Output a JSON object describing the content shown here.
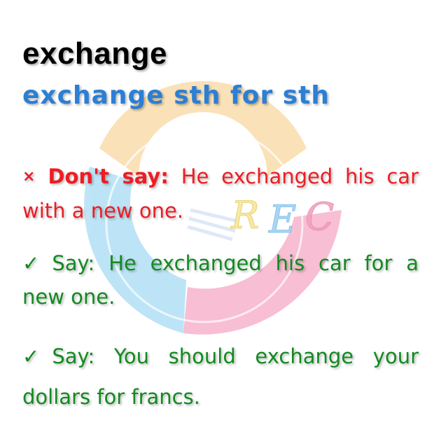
{
  "watermark": {
    "text": "REC",
    "colors": {
      "orange": "#f9d7a0",
      "blue": "#a8dcf3",
      "pink": "#f6a9c5",
      "rec_yellow": "#f6e79b",
      "rec_blue": "#9ed3f2",
      "rec_pink": "#f4a2c2"
    }
  },
  "heading": {
    "word": "exchange",
    "pattern": "exchange sth for sth"
  },
  "wrong": {
    "icon": "×",
    "label": "Don't say:",
    "sentence": "He exchanged his car with a new one."
  },
  "correct": [
    {
      "icon": "✓",
      "label": "Say:",
      "sentence": "He exchanged his car for a new one."
    },
    {
      "icon": "✓",
      "label": "Say:",
      "sentence": "You should exchange your dollars for francs."
    }
  ],
  "colors": {
    "title": "#000000",
    "pattern": "#2b7fd4",
    "wrong": "#ee1c24",
    "correct": "#138a21"
  }
}
